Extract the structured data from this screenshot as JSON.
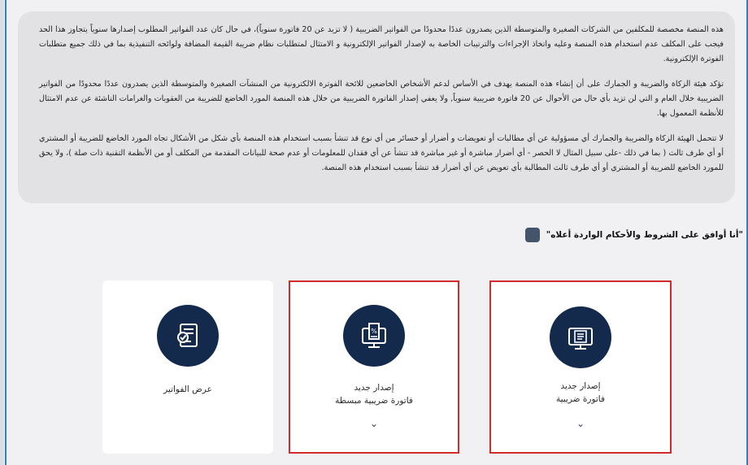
{
  "notice": {
    "paragraphs": [
      "هذه المنصة مخصصة للمكلفين من الشركات الصغيرة والمتوسطة الذين يصدرون عددًا محدودًا من الفواتير الضريبية ( لا تزيد عن 20 فاتورة سنوياً)، في حال كان عدد الفواتير المطلوب إصدارها سنوياً يتجاوز هذا الحد فيجب على المكلف عدم استخدام هذه المنصة وعليه واتخاذ الإجراءات والترتيبات الخاصة به لإصدار الفواتير الإلكترونية و الامتثال لمتطلبات نظام ضريبة القيمة المضافة ولوائحه التنفيذية بما في ذلك جميع متطلبات الفوترة الإلكترونية.",
      "تؤكد هيئة الزكاة والضريبة و الجمارك على أن إنشاء هذه المنصة يهدف في الأساس لدعم الأشخاص الخاضعين للائحة الفوترة الالكترونية من المنشآت الصغيرة والمتوسطة الذين يصدرون عددًا محدودًا من الفواتير الضريبية خلال العام و التي لن تزيد بأي حال من الأحوال عن 20 فاتورة ضريبية سنوياً, ولا يعفي إصدار الفاتورة الضريبية من خلال هذه المنصة المورد الخاضع للضريبة من العقوبات والغرامات الناشئة عن عدم الامتثال للأنظمة المعمول بها.",
      "لا تتحمل الهيئة الزكاة والضريبة والجمارك أي مسؤولية عن أي مطالبات أو تعويضات و أضرار أو خسائر من أي نوع قد تنشأ بسبب استخدام هذه المنصة بأي شكل من الأشكال تجاه المورد الخاضع للضريبة أو المشتري أو أي طرف ثالث ( بما في ذلك -على سبيل المثال لا الحصر - أي أضرار مباشرة أو غير مباشرة قد تنشأ عن أي فقدان للمعلومات أو عدم صحة للبيانات المقدمة من المكلف أو من الأنظمة التقنية ذات صلة )، ولا يحق للمورد الخاضع للضريبة أو المشتري أو أي طرف ثالث المطالبة بأي تعويض عن أي أضرار قد تنشأ بسبب استخدام هذه المنصة."
    ]
  },
  "agreement": {
    "label": "\"أنا أوافق على الشروط والأحكام الواردة أعلاه\"",
    "checked": true
  },
  "cards": {
    "view": {
      "label": "عرض الفواتير",
      "icon": "checklist-document-icon"
    },
    "simplified": {
      "line1": "إصدار جديد",
      "line2": "فاتورة ضريبية مبسطة",
      "icon": "monitor-receipt-icon",
      "chevron": "⌄"
    },
    "standard": {
      "line1": "إصدار جديد",
      "line2": "فاتورة ضريبية",
      "icon": "monitor-invoice-icon",
      "chevron": "⌄"
    }
  },
  "colors": {
    "icon_circle": "#132a4d",
    "highlight_border": "#d22b2b",
    "panel_bg": "#e2e2e4",
    "accent": "#2f7fc1"
  }
}
